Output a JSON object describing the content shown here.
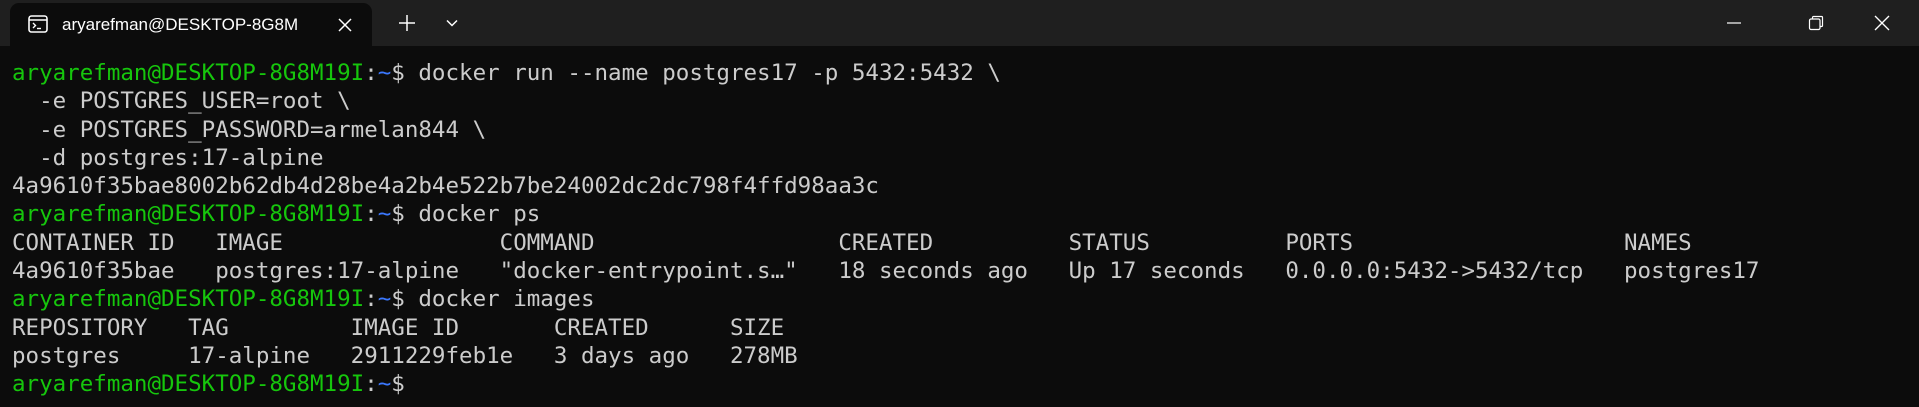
{
  "tab": {
    "title": "aryarefman@DESKTOP-8G8M",
    "icon": "terminal-icon"
  },
  "colors": {
    "titlebar_bg": "#1f1f1f",
    "terminal_bg": "#0c0c0c",
    "prompt_user": "#16c60c",
    "prompt_path": "#3b78ff",
    "text": "#cccccc"
  },
  "prompt": {
    "user_host": "aryarefman@DESKTOP-8G8M19I",
    "colon": ":",
    "path": "~",
    "symbol": "$ "
  },
  "lines": [
    {
      "prompt": true,
      "text": "docker run --name postgres17 -p 5432:5432 \\"
    },
    {
      "prompt": false,
      "text": "  -e POSTGRES_USER=root \\"
    },
    {
      "prompt": false,
      "text": "  -e POSTGRES_PASSWORD=armelan844 \\"
    },
    {
      "prompt": false,
      "text": "  -d postgres:17-alpine"
    },
    {
      "prompt": false,
      "text": "4a9610f35bae8002b62db4d28be4a2b4e522b7be24002dc2dc798f4ffd98aa3c"
    },
    {
      "prompt": true,
      "text": "docker ps"
    },
    {
      "prompt": false,
      "text": "CONTAINER ID   IMAGE                COMMAND                  CREATED          STATUS          PORTS                    NAMES"
    },
    {
      "prompt": false,
      "text": "4a9610f35bae   postgres:17-alpine   \"docker-entrypoint.s…\"   18 seconds ago   Up 17 seconds   0.0.0.0:5432->5432/tcp   postgres17"
    },
    {
      "prompt": true,
      "text": "docker images"
    },
    {
      "prompt": false,
      "text": "REPOSITORY   TAG         IMAGE ID       CREATED      SIZE"
    },
    {
      "prompt": false,
      "text": "postgres     17-alpine   2911229feb1e   3 days ago   278MB"
    },
    {
      "prompt": true,
      "text": ""
    }
  ]
}
